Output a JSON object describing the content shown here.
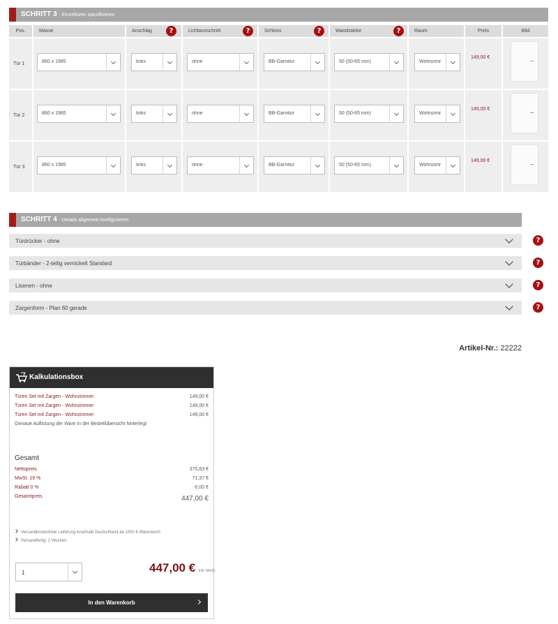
{
  "step3": {
    "label": "SCHRITT 3",
    "sub": "- Einzeltüren spezifizieren",
    "columns": {
      "pos": "Pos.",
      "masse": "Masse",
      "anschlag": "Anschlag",
      "licht": "Lichtausschnitt",
      "schloss": "Schloss",
      "wand": "Wandstärke",
      "raum": "Raum",
      "preis": "Preis",
      "bild": "Bild"
    },
    "rows": [
      {
        "pos": "Tür 1",
        "masse": "860 x 1985",
        "anschlag": "links",
        "licht": "ohne",
        "schloss": "BB-Garnitur",
        "wand": "50 (50-65 mm)",
        "raum": "Wohnzimr",
        "preis": "149,00 €"
      },
      {
        "pos": "Tür 2",
        "masse": "860 x 1985",
        "anschlag": "links",
        "licht": "ohne",
        "schloss": "BB-Garnitur",
        "wand": "50 (50-65 mm)",
        "raum": "Wohnzimr",
        "preis": "149,00 €"
      },
      {
        "pos": "Tür 3",
        "masse": "860 x 1985",
        "anschlag": "links",
        "licht": "ohne",
        "schloss": "BB-Garnitur",
        "wand": "50 (50-65 mm)",
        "raum": "Wohnzimr",
        "preis": "149,00 €"
      }
    ]
  },
  "step4": {
    "label": "SCHRITT 4",
    "sub": "- Details allgemein konfigurieren",
    "items": [
      "Türdrücker - ohne",
      "Türbänder - 2-teilig vernickelt Standard",
      "Lisenen - ohne",
      "Zargenform - Plan 60 gerade"
    ]
  },
  "artikel": {
    "label": "Artikel-Nr.:",
    "value": "22222"
  },
  "kalkulation": {
    "title": "Kalkulationsbox",
    "items": [
      {
        "name": "Türen Set mit Zargen - Wohnzimmer",
        "price": "149,00 €"
      },
      {
        "name": "Türen Set mit Zargen - Wohnzimmer",
        "price": "149,00 €"
      },
      {
        "name": "Türen Set mit Zargen - Wohnzimmer",
        "price": "149,00 €"
      }
    ],
    "note": "Genaue Auflistung der Ware in der Bestellübersicht hinterlegt",
    "gesamt_title": "Gesamt",
    "summary": [
      {
        "label": "Nettopreis",
        "value": "375,63 €"
      },
      {
        "label": "MwSt. 19 %",
        "value": "71,37 €"
      },
      {
        "label": "Rabatt 0 %",
        "value": "-0,00 €"
      },
      {
        "label": "Gesamtpreis",
        "value": "447,00 €"
      }
    ],
    "info": [
      "Versandkostenfreie Lieferung innerhalb Deutschland ab 1000 € Warenwert!",
      "Versandfertig: 2 Wochen"
    ],
    "qty": "1",
    "price_big": "447,00 €",
    "price_note": "inkl. MwSt.",
    "cart_label": "In den Warenkorb"
  },
  "colors": {
    "accent": "#a01c1c",
    "header_grey": "#a7a7a7",
    "dark": "#2f2f2f",
    "price": "#8b1a1a"
  },
  "icons": {
    "help": "help-icon",
    "cart": "cart-icon",
    "chevron": "chevron-down-icon"
  }
}
